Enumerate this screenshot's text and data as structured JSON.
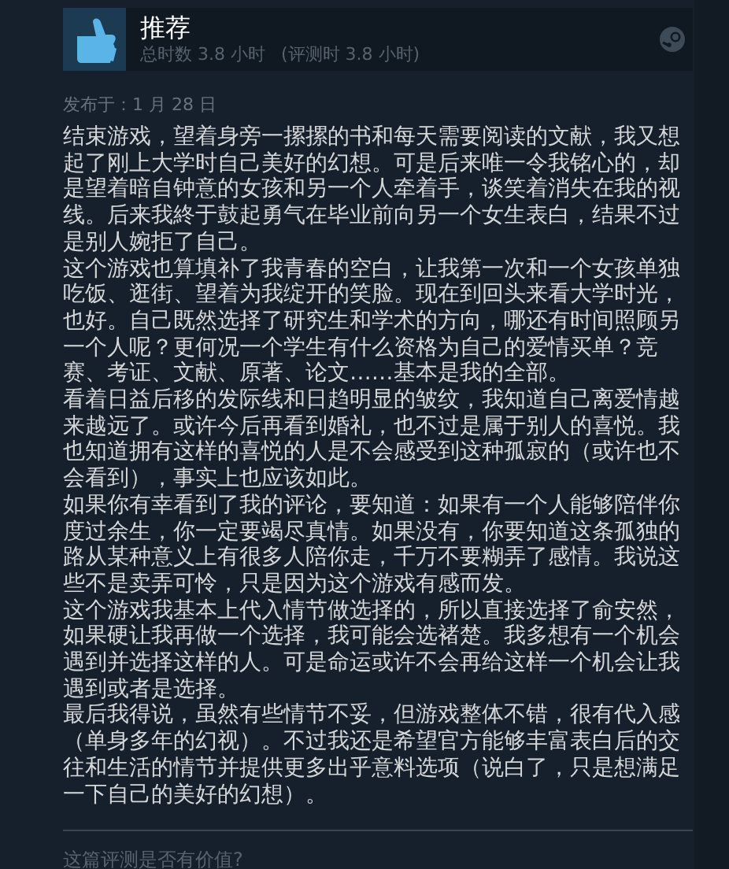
{
  "review": {
    "verdict": "推荐",
    "hours": "总时数 3.8 小时",
    "review_hours": "(评测时 3.8 小时)",
    "posted": "发布于：1 月 28 日",
    "paragraphs": [
      "结束游戏，望着身旁一摞摞的书和每天需要阅读的文献，我又想起了刚上大学时自己美好的幻想。可是后来唯一令我铭心的，却是望着暗自钟意的女孩和另一个人牵着手，谈笑着消失在我的视线。后来我終于鼓起勇气在毕业前向另一个女生表白，结果不过是别人婉拒了自己。",
      "这个游戏也算填补了我青春的空白，让我第一次和一个女孩单独吃饭、逛街、望着为我绽开的笑脸。现在到回头来看大学时光，也好。自己既然选择了研究生和学术的方向，哪还有时间照顾另一个人呢？更何况一个学生有什么资格为自己的爱情买单？竞赛、考证、文献、原著、论文……基本是我的全部。",
      "看着日益后移的发际线和日趋明显的皱纹，我知道自己离爱情越来越远了。或许今后再看到婚礼，也不过是属于别人的喜悦。我也知道拥有这样的喜悦的人是不会感受到这种孤寂的（或许也不会看到），事实上也应该如此。",
      "如果你有幸看到了我的评论，要知道：如果有一个人能够陪伴你度过余生，你一定要竭尽真情。如果没有，你要知道这条孤独的路从某种意义上有很多人陪你走，千万不要糊弄了感情。我说这些不是卖弄可怜，只是因为这个游戏有感而发。",
      "这个游戏我基本上代入情节做选择的，所以直接选择了俞安然，如果硬让我再做一个选择，我可能会选褚楚。我多想有一个机会遇到并选择这样的人。可是命运或许不会再给这样一个机会让我遇到或者是选择。",
      "最后我得说，虽然有些情节不妥，但游戏整体不错，很有代入感（单身多年的幻视）。不过我还是希望官方能够丰富表白后的交往和生活的情节并提供更多出乎意料选项（说白了，只是想满足一下自己的美好的幻想）。"
    ],
    "helpful_prompt": "这篇评测是否有价值?"
  }
}
